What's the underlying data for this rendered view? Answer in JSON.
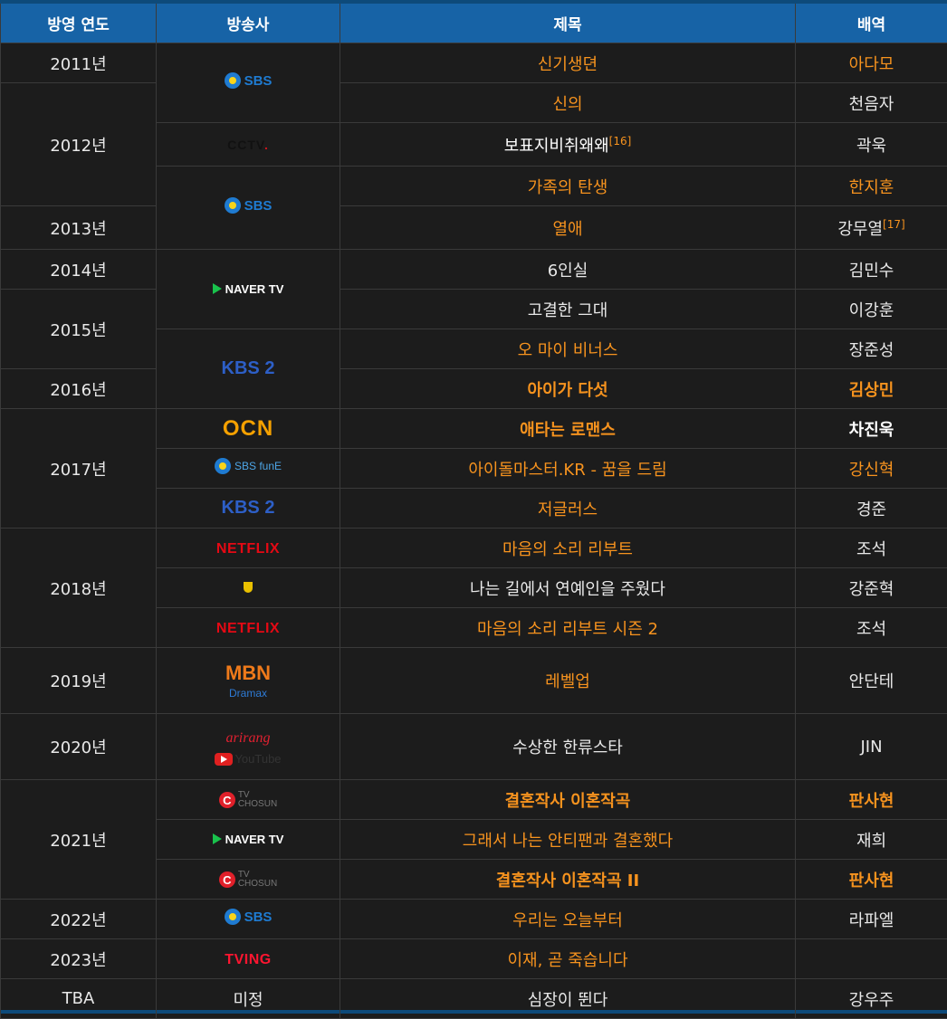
{
  "header": {
    "year": "방영 연도",
    "broadcaster": "방송사",
    "title": "제목",
    "role": "배역"
  },
  "rows": [
    {
      "year": "2011년",
      "title": "신기생뎐",
      "role": "아다모"
    },
    {
      "title": "신의",
      "role": "천음자"
    },
    {
      "year": "2012년",
      "title": "보표지비취왜왜",
      "title_note": "[16]",
      "role": "곽욱"
    },
    {
      "title": "가족의 탄생",
      "role": "한지훈"
    },
    {
      "year": "2013년",
      "title": "열애",
      "role": "강무열",
      "role_note": "[17]"
    },
    {
      "year": "2014년",
      "title": "6인실",
      "role": "김민수"
    },
    {
      "year": "2015년",
      "title": "고결한 그대",
      "role": "이강훈"
    },
    {
      "title": "오 마이 비너스",
      "role": "장준성"
    },
    {
      "year": "2016년",
      "title": "아이가 다섯",
      "role": "김상민"
    },
    {
      "year": "2017년",
      "title": "애타는 로맨스",
      "role": "차진욱"
    },
    {
      "title": "아이돌마스터.KR - 꿈을 드림",
      "role": "강신혁"
    },
    {
      "title": "저글러스",
      "role": "경준"
    },
    {
      "year": "2018년",
      "title": "마음의 소리 리부트",
      "role": "조석"
    },
    {
      "title": "나는 길에서 연예인을 주웠다",
      "role": "강준혁"
    },
    {
      "title": "마음의 소리 리부트 시즌 2",
      "role": "조석"
    },
    {
      "year": "2019년",
      "title": "레벨업",
      "role": "안단테"
    },
    {
      "year": "2020년",
      "title": "수상한 한류스타",
      "role": "JIN"
    },
    {
      "year": "2021년",
      "title": "결혼작사 이혼작곡",
      "role": "판사현"
    },
    {
      "title": "그래서 나는 안티팬과 결혼했다",
      "role": "재희"
    },
    {
      "title": "결혼작사 이혼작곡 II",
      "role": "판사현"
    },
    {
      "year": "2022년",
      "title": "우리는 오늘부터",
      "role": "라파엘"
    },
    {
      "year": "2023년",
      "title": "이재, 곧 죽습니다",
      "role": ""
    },
    {
      "year": "TBA",
      "broadcaster": "미정",
      "title": "심장이 뛴다",
      "role": "강우주"
    }
  ],
  "logos": {
    "sbs": "SBS",
    "cctv": "CCTV",
    "cctv_dot": ".",
    "naver": "NAVER TV",
    "kbs2": "KBS 2",
    "ocn": "OCN",
    "sbs_fune": "SBS funE",
    "fune": "funE",
    "netflix": "NETFLIX",
    "mbn": "MBN",
    "dramax": "Dramax",
    "arirang": "arirang",
    "youtube": "YouTube",
    "tv_chosun_tv": "TV",
    "tv_chosun_name": "CHOSUN",
    "tving": "TVING"
  },
  "colors": {
    "header_bg": "#1763a6",
    "link": "#f7931e",
    "text": "#e8e8e8",
    "background": "#1c1c1c"
  }
}
